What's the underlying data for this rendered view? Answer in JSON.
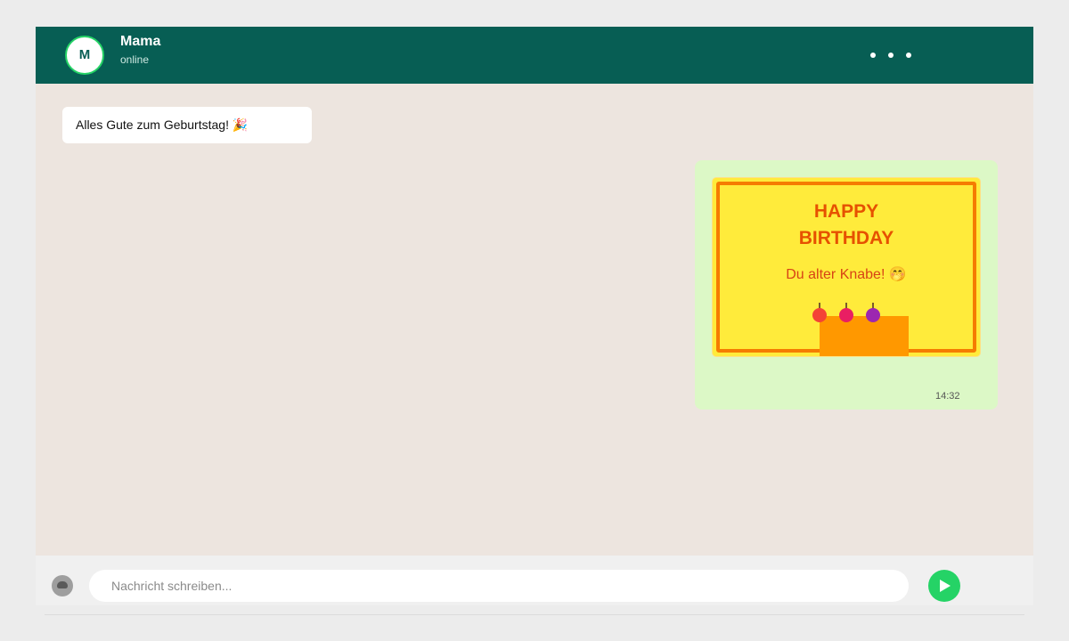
{
  "header": {
    "avatar_initial": "M",
    "contact_name": "Mama",
    "status": "online",
    "menu_icon": "more-dots-icon"
  },
  "messages": {
    "incoming": {
      "text": "Alles Gute zum Geburtstag! 🎉"
    },
    "outgoing": {
      "card": {
        "title_line1": "HAPPY",
        "title_line2": "BIRTHDAY",
        "subtitle": "Du alter Knabe! 🤭",
        "candle_colors": [
          "#f44336",
          "#e91e63",
          "#9c27b0"
        ],
        "card_color": "#ffeb3b",
        "border_color": "#f57c00",
        "cake_color": "#ff9800"
      },
      "time": "14:32"
    }
  },
  "composer": {
    "placeholder": "Nachricht schreiben...",
    "emoji_icon": "emoji-icon",
    "send_icon": "send-icon"
  },
  "colors": {
    "header": "#075e54",
    "accent": "#25d366",
    "chat_background": "#ede5df",
    "outgoing_bubble": "#dcf8c6"
  }
}
